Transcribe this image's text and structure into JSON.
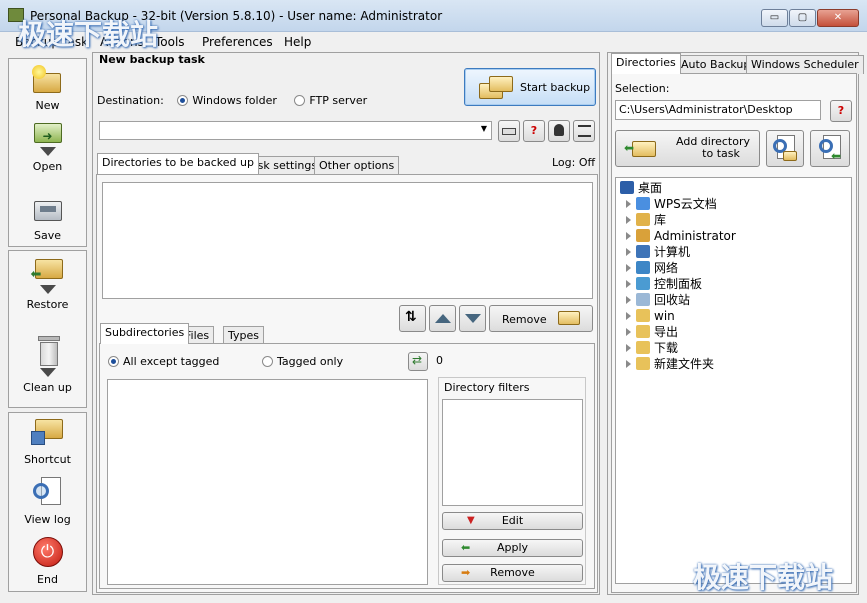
{
  "window": {
    "title": "Personal Backup - 32-bit (Version 5.8.10) - User name: Administrator",
    "controls": {
      "minimize": "▭",
      "maximize": "▢",
      "close": "✕"
    }
  },
  "menu": [
    "Backup task",
    "Actions",
    "Tools",
    "Preferences",
    "Help"
  ],
  "toolbar": {
    "new": "New",
    "open": "Open",
    "save": "Save",
    "restore": "Restore",
    "cleanup": "Clean up",
    "shortcut": "Shortcut",
    "viewlog": "View log",
    "end": "End"
  },
  "task": {
    "heading": "New backup task",
    "destination_label": "Destination:",
    "dest_options": [
      "Windows folder",
      "FTP server"
    ],
    "dest_selected": "Windows folder",
    "start_backup": "Start backup",
    "path_value": "",
    "help_q": "?",
    "tabs": [
      "Directories to be backed up",
      "Task settings",
      "Other options"
    ],
    "active_tab": "Directories to be backed up",
    "log_status": "Log: Off",
    "remove_label": "Remove",
    "sub_tabs": [
      "Subdirectories",
      "Files",
      "Types"
    ],
    "active_sub_tab": "Subdirectories",
    "filter_options": [
      "All except tagged",
      "Tagged only"
    ],
    "filter_selected": "All except tagged",
    "count": "0",
    "dir_filters_label": "Directory filters",
    "filter_buttons": [
      "Edit",
      "Apply",
      "Remove"
    ]
  },
  "right": {
    "tabs": [
      "Directories",
      "Auto Backup",
      "Windows Scheduler"
    ],
    "active_tab": "Directories",
    "selection_label": "Selection:",
    "selection_value": "C:\\Users\\Administrator\\Desktop",
    "help_q": "?",
    "add_dir_line1": "Add directory",
    "add_dir_line2": "to task",
    "tree": [
      {
        "label": "桌面",
        "icon": "desktop-icon",
        "color": "#2c5ea8",
        "root": true
      },
      {
        "label": "WPS云文档",
        "icon": "cloud-icon",
        "color": "#4a8fe0"
      },
      {
        "label": "库",
        "icon": "library-icon",
        "color": "#e1b24a"
      },
      {
        "label": "Administrator",
        "icon": "user-icon",
        "color": "#d9a13a"
      },
      {
        "label": "计算机",
        "icon": "computer-icon",
        "color": "#3e74b8"
      },
      {
        "label": "网络",
        "icon": "network-icon",
        "color": "#3d86c6"
      },
      {
        "label": "控制面板",
        "icon": "control-panel-icon",
        "color": "#4b9bd2"
      },
      {
        "label": "回收站",
        "icon": "recycle-bin-icon",
        "color": "#9bb8d6"
      },
      {
        "label": "win",
        "icon": "folder-icon",
        "color": "#e8c25a"
      },
      {
        "label": "导出",
        "icon": "folder-icon",
        "color": "#e8c25a"
      },
      {
        "label": "下载",
        "icon": "folder-icon",
        "color": "#e8c25a"
      },
      {
        "label": "新建文件夹",
        "icon": "folder-icon",
        "color": "#e8c25a"
      }
    ]
  },
  "watermark": {
    "top": "极速下载站",
    "bottom": "极速下载站"
  }
}
